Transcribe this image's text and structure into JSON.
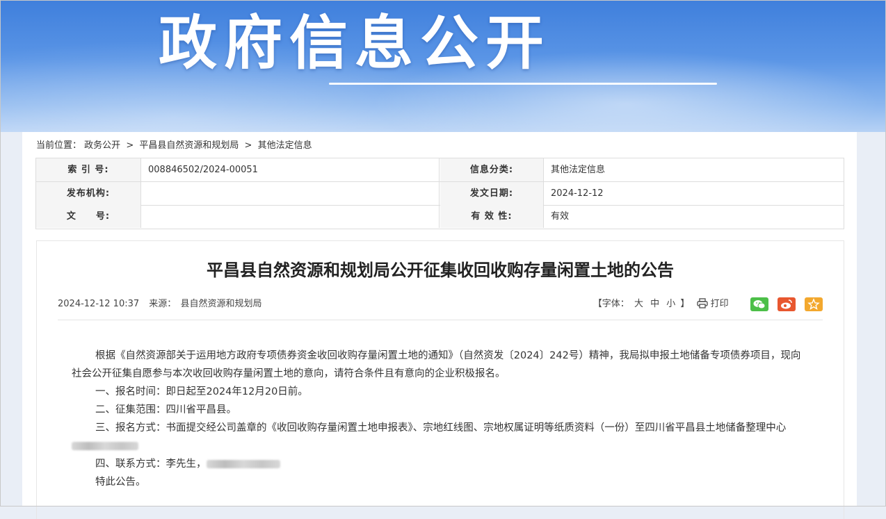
{
  "banner": {
    "title": "政府信息公开"
  },
  "breadcrumb": {
    "label": "当前位置：",
    "items": [
      "政务公开",
      "平昌县自然资源和规划局",
      "其他法定信息"
    ],
    "separator": ">"
  },
  "meta": {
    "index_label": "索 引 号:",
    "index_value": "008846502/2024-00051",
    "category_label": "信息分类:",
    "category_value": "其他法定信息",
    "publisher_label": "发布机构:",
    "publisher_value": "",
    "date_label": "发文日期:",
    "date_value": "2024-12-12",
    "docno_label": "文　　号:",
    "docno_value": "",
    "validity_label": "有 效 性:",
    "validity_value": "有效"
  },
  "article": {
    "title": "平昌县自然资源和规划局公开征集收回收购存量闲置土地的公告",
    "datetime": "2024-12-12 10:37",
    "source_label": "来源：",
    "source_value": "县自然资源和规划局",
    "font_label": "【字体：",
    "font_large": "大",
    "font_medium": "中",
    "font_small": "小",
    "font_end": "】",
    "print_label": "打印",
    "paragraphs": {
      "p1": "根据《自然资源部关于运用地方政府专项债券资金收回收购存量闲置土地的通知》（自然资发〔2024〕242号）精神，我局拟申报土地储备专项债券项目，现向社会公开征集自愿参与本次收回收购存量闲置土地的意向，请符合条件且有意向的企业积极报名。",
      "p2": "一、报名时间：即日起至2024年12月20日前。",
      "p3": "二、征集范围：四川省平昌县。",
      "p4": "三、报名方式：书面提交经公司盖章的《收回收购存量闲置土地申报表》、宗地红线图、宗地权属证明等纸质资料（一份）至四川省平昌县土地储备整理中心",
      "p5": "四、联系方式：李先生，",
      "p6": "特此公告。"
    }
  },
  "colors": {
    "wechat": "#4cbf48",
    "weibo": "#e8572f",
    "favorite": "#f3a82e"
  },
  "icons": [
    "print-icon",
    "wechat-icon",
    "weibo-icon",
    "star-icon"
  ]
}
